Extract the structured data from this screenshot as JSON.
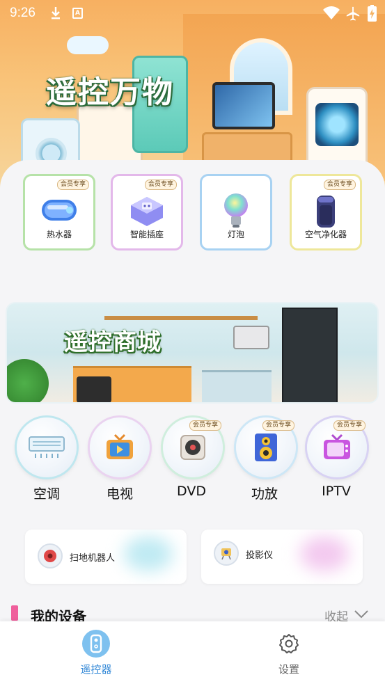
{
  "status_bar": {
    "time": "9:26",
    "a_label": "A"
  },
  "hero": {
    "title": "遥控万物"
  },
  "feature_cards": [
    {
      "label": "热水器",
      "badge": "会员专享",
      "border": "#b6e2a8",
      "icon": "water-heater-icon"
    },
    {
      "label": "智能插座",
      "badge": "会员专享",
      "border": "#e3b8ea",
      "icon": "smart-socket-icon"
    },
    {
      "label": "灯泡",
      "badge": "",
      "border": "#a8d2f2",
      "icon": "light-bulb-icon"
    },
    {
      "label": "空气净化器",
      "badge": "会员专享",
      "border": "#eee79a",
      "icon": "air-purifier-icon"
    }
  ],
  "banner": {
    "title": "遥控商城"
  },
  "device_types": [
    {
      "label": "空调",
      "badge": "",
      "icon": "air-conditioner-icon"
    },
    {
      "label": "电视",
      "badge": "",
      "icon": "tv-icon"
    },
    {
      "label": "DVD",
      "badge": "会员专享",
      "icon": "dvd-icon"
    },
    {
      "label": "功放",
      "badge": "会员专享",
      "icon": "amplifier-icon"
    },
    {
      "label": "IPTV",
      "badge": "会员专享",
      "icon": "iptv-icon"
    }
  ],
  "wide_cards": [
    {
      "label": "扫地机器人",
      "icon": "robot-vacuum-icon",
      "accent": "#bfeaf3"
    },
    {
      "label": "投影仪",
      "icon": "projector-icon",
      "accent": "#f3c9ef"
    }
  ],
  "my_devices": {
    "title": "我的设备",
    "collapse_label": "收起",
    "accent": "#ef5f9c"
  },
  "bottom_nav": [
    {
      "label": "遥控器",
      "icon": "remote-icon",
      "active": true,
      "color": "#2f86d6"
    },
    {
      "label": "设置",
      "icon": "gear-icon",
      "active": false,
      "color": "#666666"
    }
  ]
}
